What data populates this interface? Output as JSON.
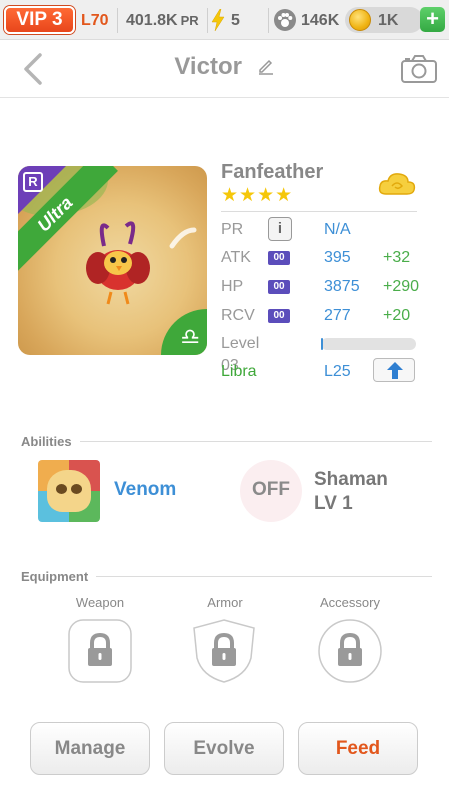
{
  "topbar": {
    "vip": "VIP 3",
    "level": "L70",
    "pr_value": "401.8K",
    "pr_unit": "PR",
    "energy": "5",
    "paws": "146K",
    "coins": "1K",
    "plus_label": "+"
  },
  "header": {
    "title": "Victor"
  },
  "pet": {
    "rarity": "Ultra",
    "rarity_icon": "R",
    "zodiac_symbol": "♎",
    "name": "Fanfeather",
    "stars": "★★★★",
    "star_count": 4
  },
  "stats": {
    "pr": {
      "label": "PR",
      "info": "i",
      "value": "N/A"
    },
    "atk": {
      "label": "ATK",
      "chip": "00",
      "value": "395",
      "bonus": "+32"
    },
    "hp": {
      "label": "HP",
      "chip": "00",
      "value": "3875",
      "bonus": "+290"
    },
    "rcv": {
      "label": "RCV",
      "chip": "00",
      "value": "277",
      "bonus": "+20"
    },
    "level": {
      "label": "Level 03",
      "xp_fraction": 0.02
    },
    "zodiac": {
      "label": "Libra",
      "value": "L25"
    }
  },
  "abilities": {
    "title": "Abilities",
    "items": [
      {
        "name": "Venom"
      },
      {
        "status": "OFF",
        "name": "Shaman",
        "level": "LV 1"
      }
    ]
  },
  "equipment": {
    "title": "Equipment",
    "slots": [
      {
        "label": "Weapon"
      },
      {
        "label": "Armor"
      },
      {
        "label": "Accessory"
      }
    ]
  },
  "actions": {
    "manage": "Manage",
    "evolve": "Evolve",
    "feed": "Feed"
  },
  "colors": {
    "accent_orange": "#e2571c",
    "blue": "#3d8fd6",
    "green": "#4aad4a",
    "purple": "#5b4dbb"
  },
  "icons": {
    "back": "chevron-left-icon",
    "edit": "pencil-icon",
    "camera": "camera-icon",
    "energy": "lightning-icon",
    "paw": "paw-icon",
    "coin": "coin-icon",
    "lock": "lock-icon",
    "upgrade": "arrow-up-icon"
  }
}
